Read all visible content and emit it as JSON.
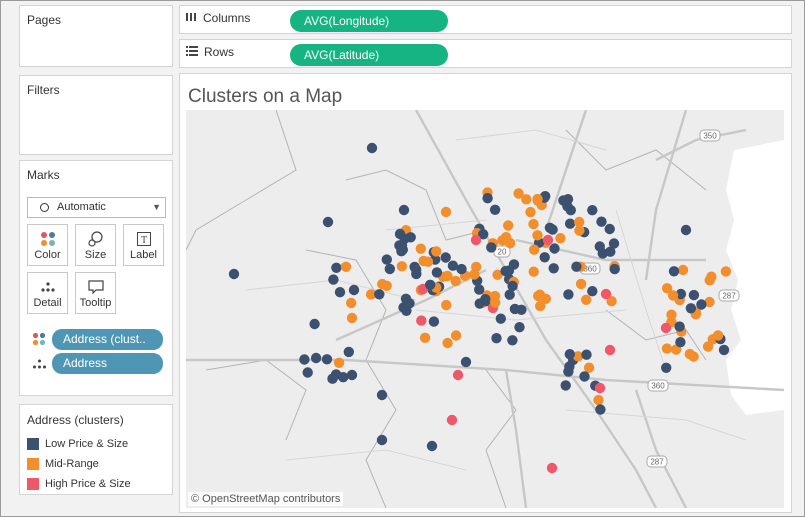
{
  "shelves": {
    "pages_label": "Pages",
    "columns_label": "Columns",
    "columns_pill": "AVG(Longitude)",
    "rows_label": "Rows",
    "rows_pill": "AVG(Latitude)"
  },
  "filters_label": "Filters",
  "marks": {
    "title": "Marks",
    "mark_type": "Automatic",
    "buttons": {
      "color": "Color",
      "size": "Size",
      "label": "Label",
      "detail": "Detail",
      "tooltip": "Tooltip"
    },
    "label_icon_glyph": "T",
    "fields": [
      "Address (clust..",
      "Address"
    ]
  },
  "legend": {
    "title": "Address (clusters)",
    "items": [
      {
        "label": "Low Price & Size",
        "color": "#3c5070"
      },
      {
        "label": "Mid-Range",
        "color": "#f28e2b"
      },
      {
        "label": "High Price & Size",
        "color": "#f0586a"
      }
    ]
  },
  "viz": {
    "title": "Clusters on a Map",
    "credit": "© OpenStreetMap contributors",
    "road_labels": [
      "350",
      "287",
      "360",
      "287",
      "20",
      "360"
    ]
  },
  "colors": {
    "pill_green": "#17b483",
    "field_pill": "#4e96b4",
    "low": "#3c5070",
    "mid": "#f28e2b",
    "high": "#f0586a"
  }
}
